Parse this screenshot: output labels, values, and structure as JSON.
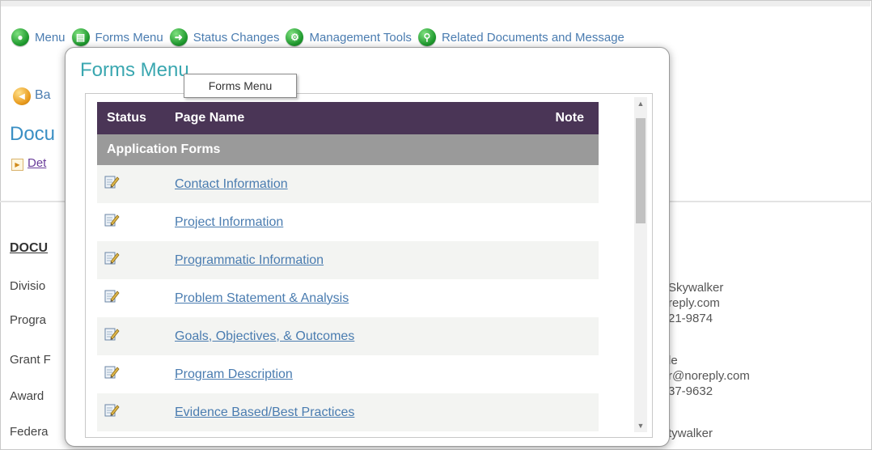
{
  "nav": {
    "items": [
      {
        "label": "Menu",
        "icon": "home-icon"
      },
      {
        "label": "Forms Menu",
        "icon": "forms-icon"
      },
      {
        "label": "Status Changes",
        "icon": "arrow-right-icon"
      },
      {
        "label": "Management Tools",
        "icon": "tools-icon"
      },
      {
        "label": "Related Documents and Message",
        "icon": "search-icon"
      }
    ]
  },
  "background": {
    "back_label": "Ba",
    "doc_title": "Docu",
    "details_link": "Det",
    "section_heading": "DOCU",
    "labels": [
      "Divisio",
      "Progra",
      "Grant F",
      "Award",
      "Federa"
    ],
    "right_block_1": [
      "Skywalker",
      "reply.com",
      "21-9874"
    ],
    "right_block_2": [
      "le",
      "r@noreply.com",
      "37-9632"
    ],
    "right_block_3": [
      "tywalker"
    ]
  },
  "popup": {
    "title": "Forms Menu",
    "tooltip": "Forms Menu",
    "table": {
      "headers": {
        "status": "Status",
        "page_name": "Page Name",
        "note": "Note"
      },
      "group": "Application Forms",
      "rows": [
        {
          "page_name": "Contact Information"
        },
        {
          "page_name": "Project Information"
        },
        {
          "page_name": "Programmatic Information"
        },
        {
          "page_name": "Problem Statement & Analysis"
        },
        {
          "page_name": "Goals, Objectives, & Outcomes"
        },
        {
          "page_name": "Program Description"
        },
        {
          "page_name": "Evidence Based/Best Practices"
        }
      ]
    }
  },
  "colors": {
    "header_bg": "#4a3556",
    "group_bg": "#9a9a9a",
    "link": "#4a7cb0",
    "title": "#3aa7b0"
  }
}
